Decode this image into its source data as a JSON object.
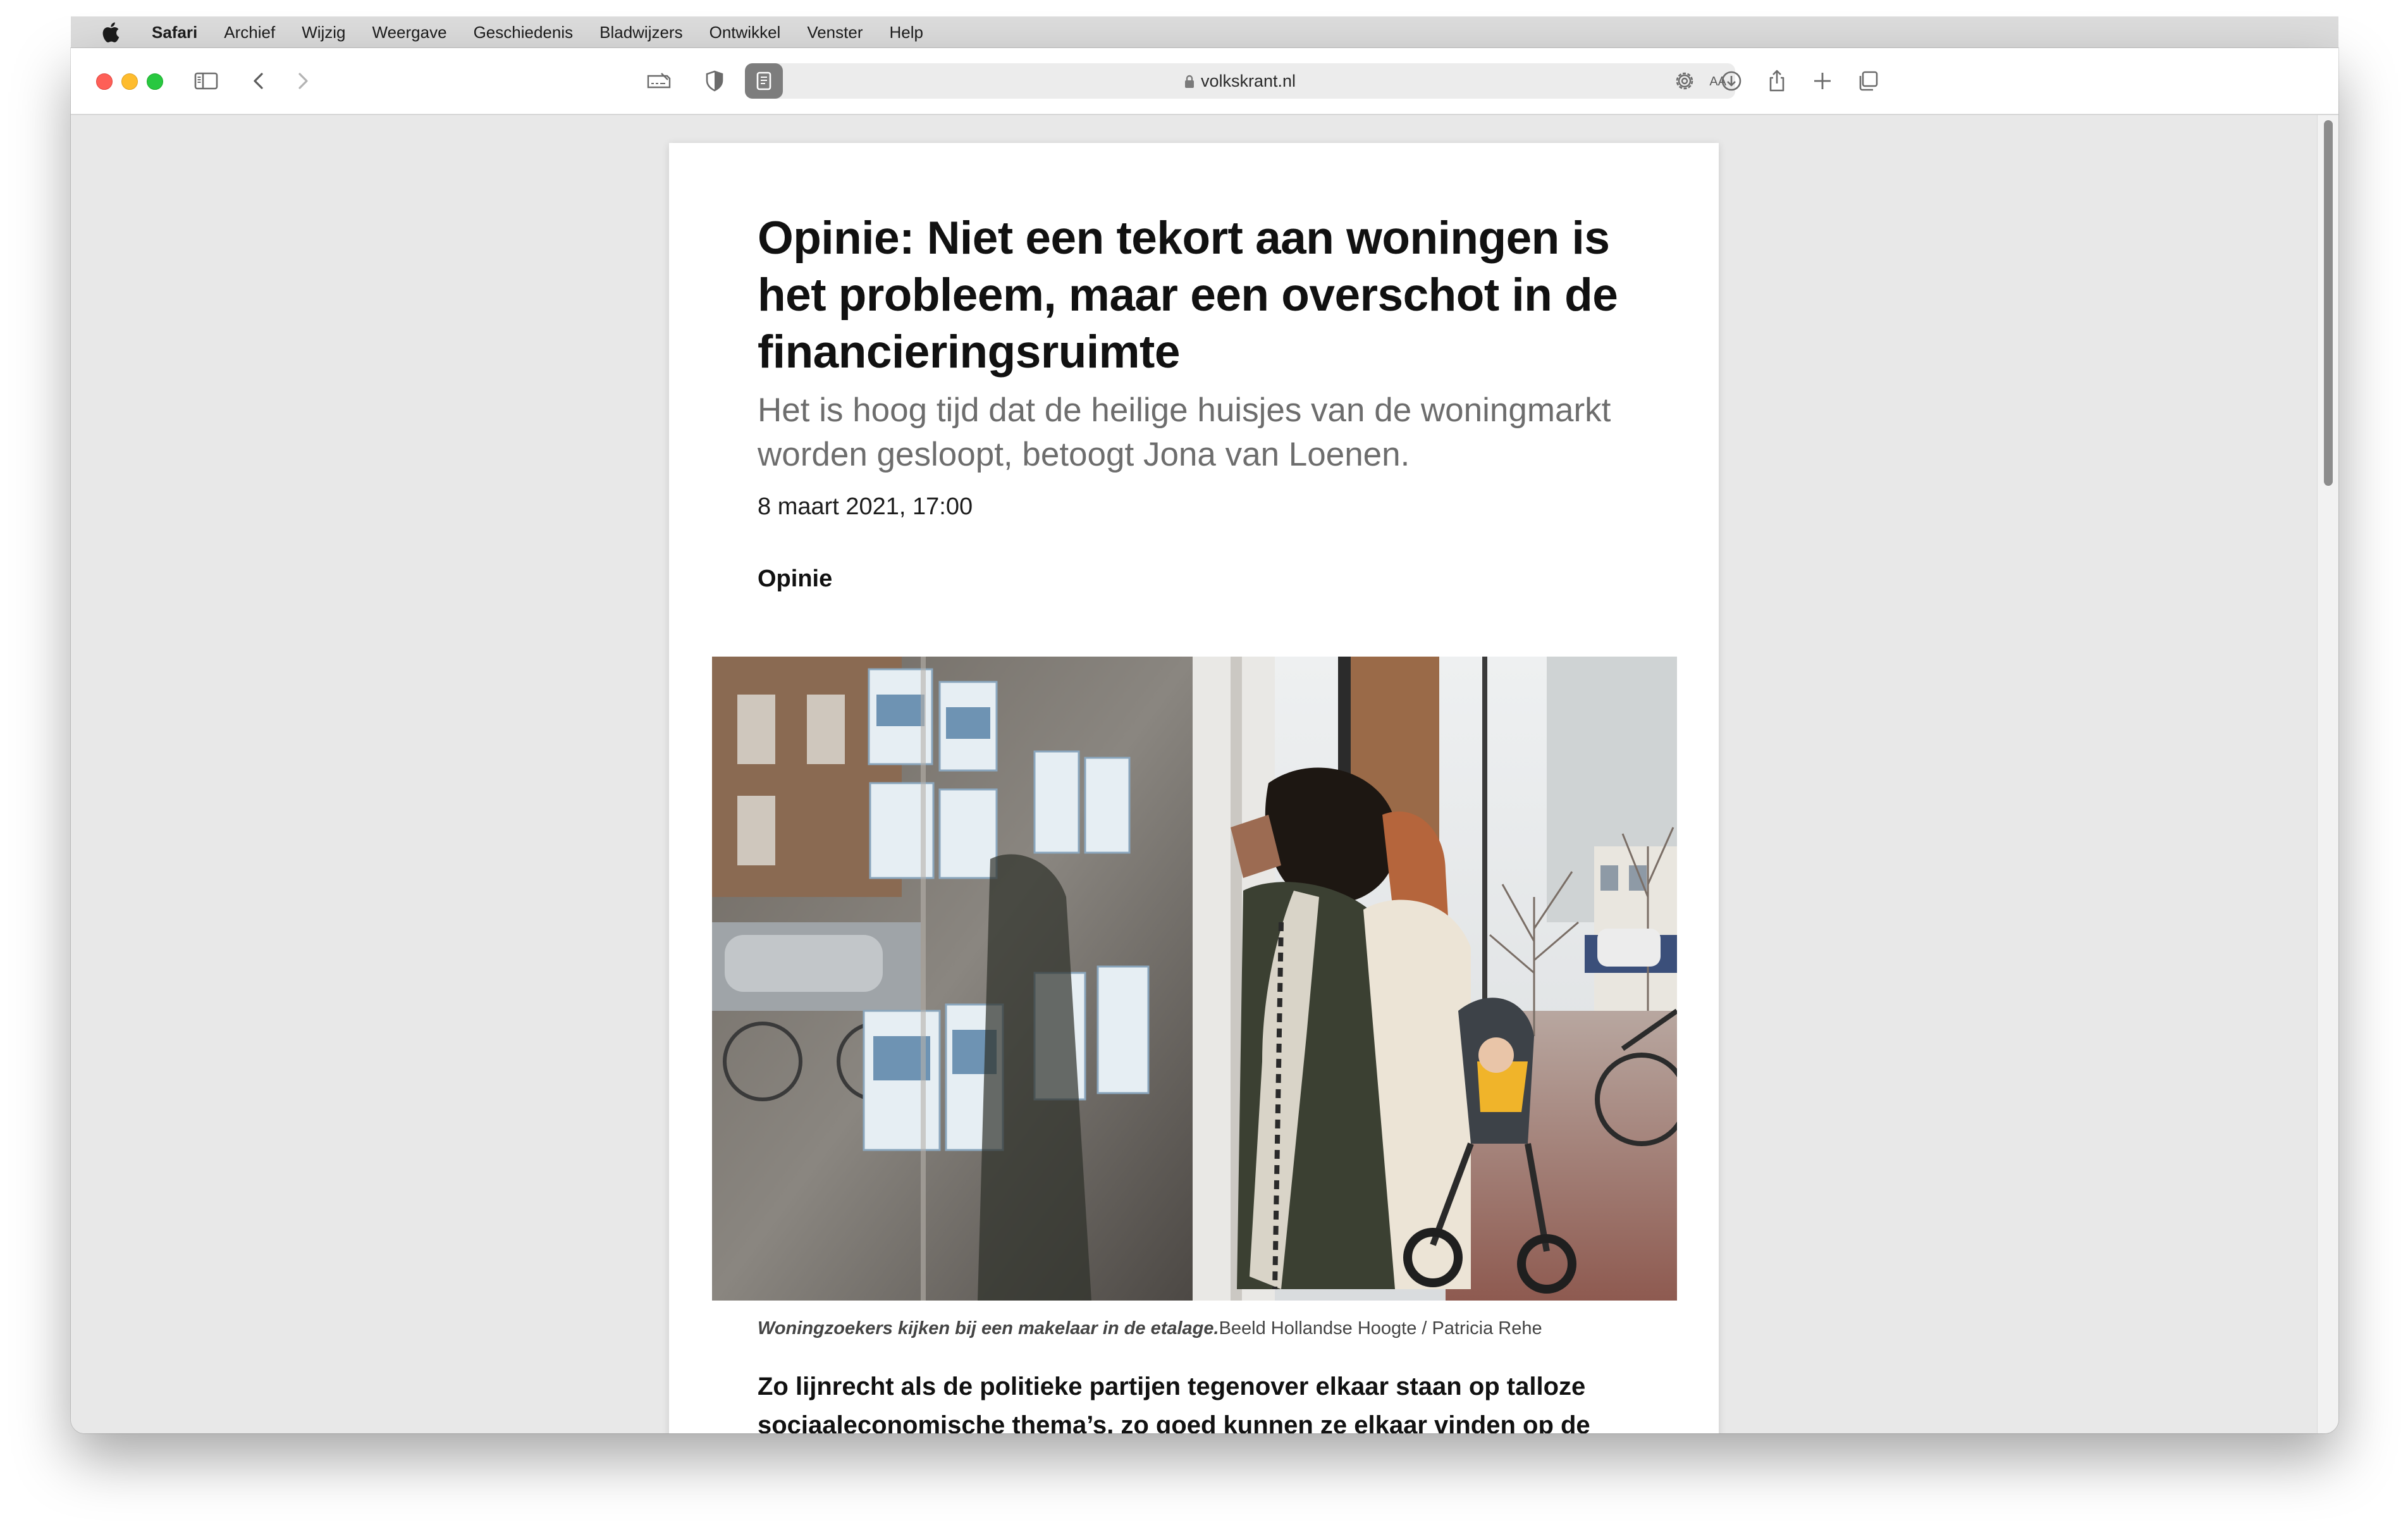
{
  "menubar": {
    "app_name": "Safari",
    "items": [
      "Archief",
      "Wijzig",
      "Weergave",
      "Geschiedenis",
      "Bladwijzers",
      "Ontwikkel",
      "Venster",
      "Help"
    ]
  },
  "toolbar": {
    "url": "volkskrant.nl",
    "text_size_label": "AA",
    "icons": [
      "sidebar-icon",
      "back-icon",
      "forward-icon",
      "reading-list-icon",
      "privacy-shield-icon",
      "reader-view-icon",
      "settings-icon",
      "download-icon",
      "share-icon",
      "new-tab-icon",
      "tab-overview-icon"
    ]
  },
  "article": {
    "title": "Opinie: Niet een tekort aan woningen is het probleem, maar een overschot in de financieringsruimte",
    "subtitle": "Het is hoog tijd dat de heilige huisjes van de woningmarkt worden gesloopt, betoogt Jona van Loenen.",
    "date": "8 maart 2021, 17:00",
    "section": "Opinie",
    "caption_main": "Woningzoekers kijken bij een makelaar in de etalage.",
    "caption_credit": "Beeld Hollandse Hoogte / Patricia Rehe",
    "body": "Zo lijnrecht als de politieke partijen tegenover elkaar staan op talloze sociaaleconomische thema’s, zo goed kunnen ze elkaar vinden op de woningmarkt. Alle partijen zien hetzelfde probleem en hebben ook dezelfde"
  },
  "colors": {
    "close": "#fe5f57",
    "minimize": "#febc2e",
    "zoom": "#28c840"
  }
}
